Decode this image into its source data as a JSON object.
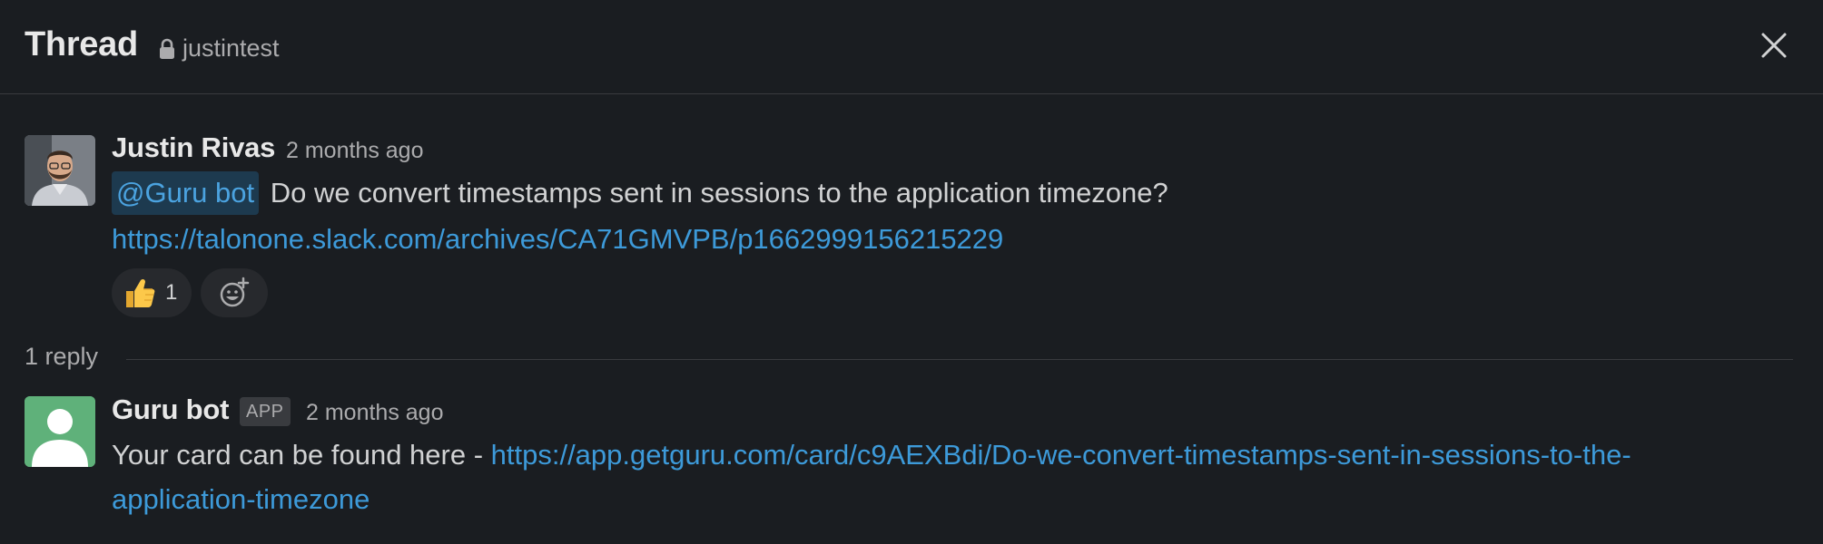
{
  "header": {
    "title": "Thread",
    "channel": "justintest",
    "close_icon": "close-icon",
    "lock_icon": "lock-icon"
  },
  "parent_message": {
    "author": "Justin Rivas",
    "time": "2 months ago",
    "mention": "@Guru bot",
    "text": "Do we convert timestamps sent in sessions to the application timezone?",
    "link": "https://talonone.slack.com/archives/CA71GMVPB/p1662999156215229",
    "reactions": [
      {
        "emoji": "👍",
        "count": "1"
      }
    ],
    "add_reaction_icon": "add-reaction-icon"
  },
  "replies": {
    "label": "1 reply"
  },
  "reply_message": {
    "author": "Guru bot",
    "badge": "APP",
    "time": "2 months ago",
    "text": "Your card can be found here - ",
    "link_line1": "https://app.getguru.com/card/c9AEXBdi/Do-we-convert-timestamps-sent-in-sessions-to-the-",
    "link_line2": "application-timezone"
  },
  "colors": {
    "background": "#1a1d21",
    "link": "#3d9ad9",
    "mention_bg": "#1d3a4f",
    "bot_avatar": "#5fb17a"
  }
}
